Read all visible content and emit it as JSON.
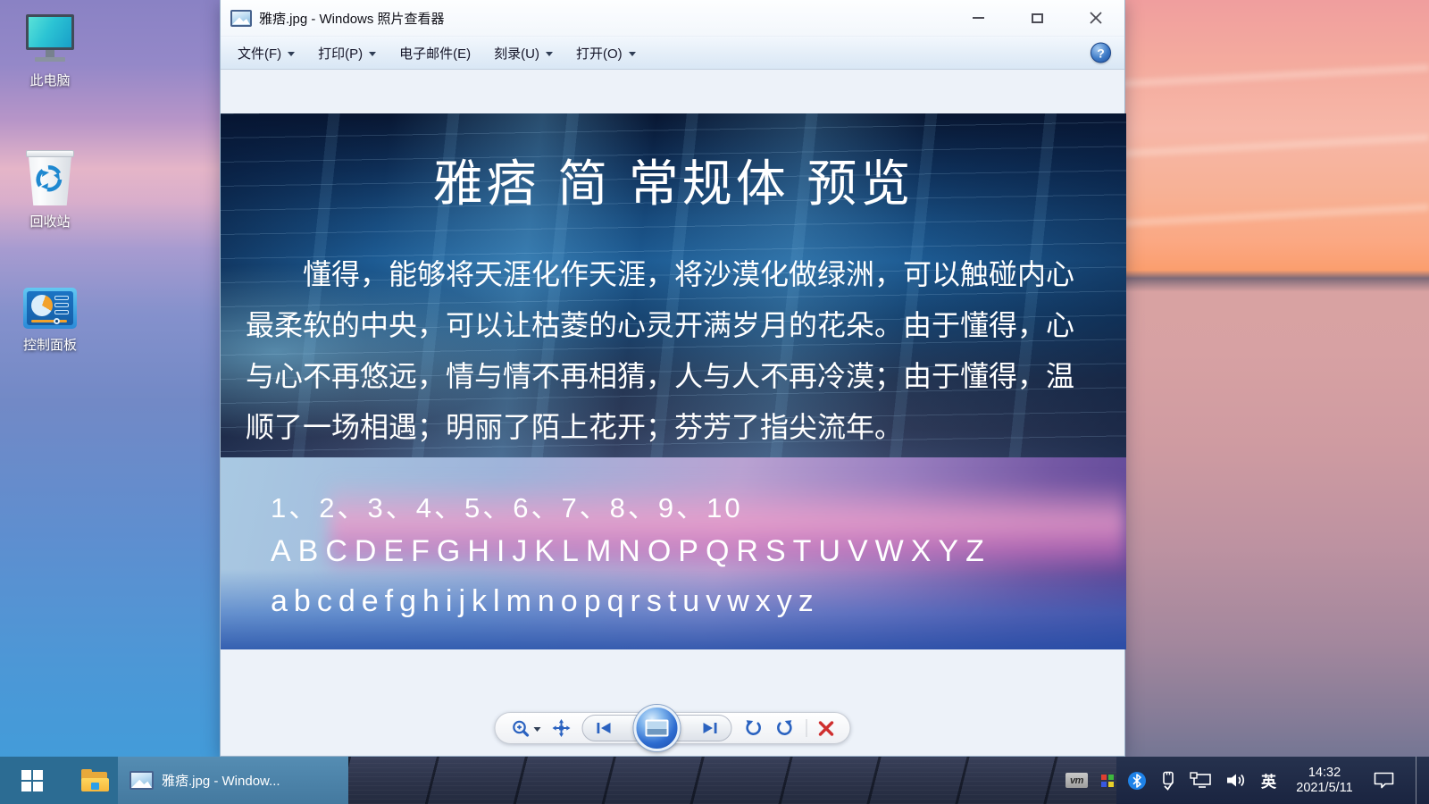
{
  "viewer": {
    "title": "雅痞.jpg - Windows 照片查看器",
    "menu": [
      {
        "label": "文件(F)",
        "dropdown": true
      },
      {
        "label": "打印(P)",
        "dropdown": true
      },
      {
        "label": "电子邮件(E)",
        "dropdown": false
      },
      {
        "label": "刻录(U)",
        "dropdown": true
      },
      {
        "label": "打开(O)",
        "dropdown": true
      }
    ],
    "help_label": "?",
    "image": {
      "heading": "雅痞 简 常规体 预览",
      "lines": [
        "懂得，能够将天涯化作天涯，将沙漠化做绿洲，可以触碰内心",
        "最柔软的中央，可以让枯菱的心灵开满岁月的花朵。由于懂得，心",
        "与心不再悠远，情与情不再相猜，人与人不再冷漠；由于懂得，温",
        "顺了一场相遇；明丽了陌上花开；芬芳了指尖流年。"
      ],
      "numbers": "1、2、3、4、5、6、7、8、9、10",
      "uppercase": "ABCDEFGHIJKLMNOPQRSTUVWXYZ",
      "lowercase": "abcdefghijklmnopqrstuvwxyz"
    },
    "toolbar_icons": [
      "zoom",
      "actual-size",
      "previous",
      "slideshow",
      "next",
      "rotate-counterclockwise",
      "rotate-clockwise",
      "delete"
    ]
  },
  "desktop": {
    "icons": [
      {
        "label": "此电脑"
      },
      {
        "label": "回收站"
      },
      {
        "label": "控制面板"
      }
    ]
  },
  "taskbar": {
    "app_button_label": "雅痞.jpg - Window...",
    "ime": "英",
    "time": "14:32",
    "date": "2021/5/11",
    "tray_icons": [
      "vmware",
      "color-grid",
      "bluetooth",
      "usb",
      "network",
      "volume"
    ]
  },
  "colors": {
    "toolbar_icon_blue": "#2a62c0",
    "delete_red": "#cf2f2f",
    "taskbar_active": "#4d87ae",
    "image_base_blue": "#12335f"
  }
}
